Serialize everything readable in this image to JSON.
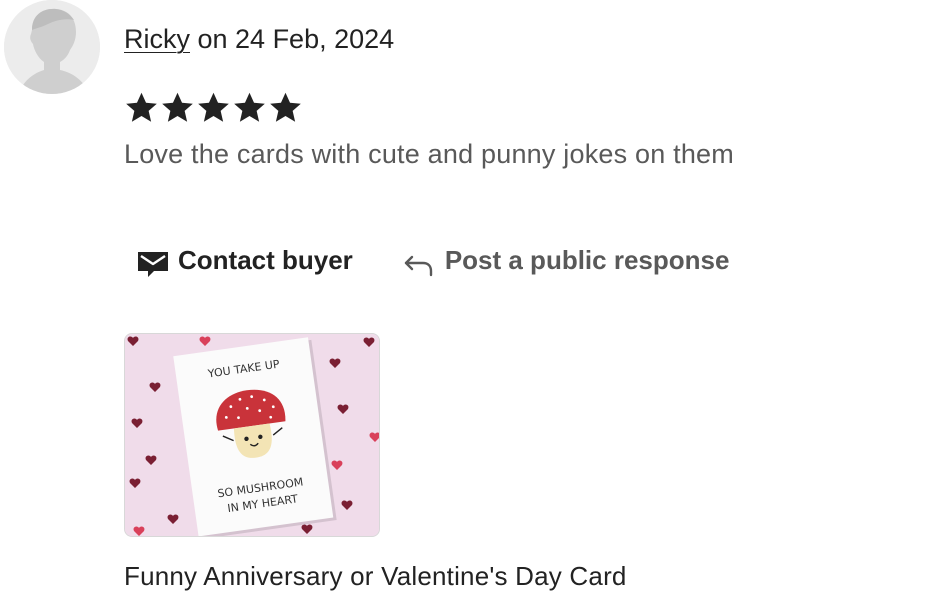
{
  "review": {
    "reviewer_name": "Ricky",
    "date_text": " on 24 Feb, 2024",
    "rating": 5,
    "rating_max": 5,
    "text": "Love the cards with cute and punny jokes on them"
  },
  "actions": {
    "contact_buyer_label": "Contact buyer",
    "post_response_label": "Post a public response"
  },
  "product": {
    "title": "Funny Anniversary or Valentine's Day Card",
    "card_text": {
      "line1": "YOU TAKE UP",
      "line2": "SO MUSHROOM",
      "line3": "IN MY HEART"
    }
  },
  "icons": {
    "avatar": "person-silhouette-icon",
    "star": "star-icon",
    "contact": "envelope-icon",
    "reply": "reply-arrow-icon"
  },
  "colors": {
    "text_primary": "#222222",
    "text_secondary": "#595959",
    "avatar_bg": "#ececec",
    "card_bg": "#f0dcea",
    "mushroom_cap": "#c9333a"
  }
}
